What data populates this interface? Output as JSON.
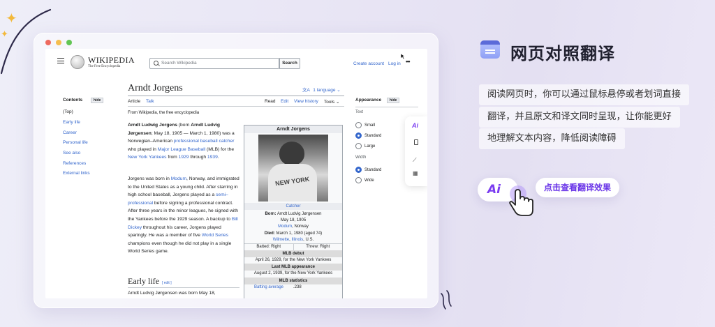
{
  "wiki": {
    "logo_title": "WIKIPEDIA",
    "logo_subtitle": "The Free Encyclopedia",
    "search_placeholder": "Search Wikipedia",
    "search_button": "Search",
    "create_account": "Create account",
    "login": "Log in",
    "more": "•••"
  },
  "toc": {
    "title": "Contents",
    "hide": "hide",
    "items": [
      "(Top)",
      "Early life",
      "Career",
      "Personal life",
      "See also",
      "References",
      "External links"
    ]
  },
  "article": {
    "title": "Arndt Jorgens",
    "language": "1 language",
    "tabs": [
      "Article",
      "Talk"
    ],
    "actions": [
      "Read",
      "Edit",
      "View history",
      "Tools"
    ],
    "from": "From Wikipedia, the free encyclopedia",
    "para1": [
      {
        "t": "Arndt Ludwig Jorgens",
        "s": "b"
      },
      {
        "t": " (born "
      },
      {
        "t": "Arndt Ludvig Jørgensen",
        "s": "b"
      },
      {
        "t": "; May 18, 1905 — March 1, 1980) was a Norwegian–American "
      },
      {
        "t": "professional baseball",
        "s": "a"
      },
      {
        "t": " "
      },
      {
        "t": "catcher",
        "s": "a"
      },
      {
        "t": " who played in "
      },
      {
        "t": "Major League Baseball",
        "s": "a"
      },
      {
        "t": " (MLB) for the "
      },
      {
        "t": "New York Yankees",
        "s": "a"
      },
      {
        "t": " from "
      },
      {
        "t": "1929",
        "s": "a"
      },
      {
        "t": " through "
      },
      {
        "t": "1939",
        "s": "a"
      },
      {
        "t": "."
      }
    ],
    "para2": [
      {
        "t": "Jorgens was born in "
      },
      {
        "t": "Modum",
        "s": "a"
      },
      {
        "t": ", Norway, and immigrated to the United States as a young child. After starring in high school baseball, Jorgens played as a "
      },
      {
        "t": "semi–professional",
        "s": "a"
      },
      {
        "t": " before signing a professional contract. After three years in the minor leagues, he signed with the Yankees before the 1929 season. A backup to "
      },
      {
        "t": "Bill Dickey",
        "s": "a"
      },
      {
        "t": " throughout his career, Jorgens played sparingly. He was a member of five "
      },
      {
        "t": "World Series",
        "s": "a"
      },
      {
        "t": " champions even though he did not play in a single World Series game."
      }
    ],
    "early_life": "Early life",
    "edit": "[ edit ]",
    "para3": "Arndt Ludvig Jørgensen was born May 18,"
  },
  "infobox": {
    "name": "Arndt Jorgens",
    "position": "Catcher",
    "born_label": "Born:",
    "born_name": "Arndt Ludvig Jørgensen",
    "born_date": "May 18, 1905",
    "born_place": "Modum",
    "born_country": ", Norway",
    "died_label": "Died:",
    "died_date": "March 1, 1980 (aged 74)",
    "died_place_a": "Wilmette",
    "died_place_b": "Illinois",
    "died_country": ", U.S.",
    "batted": "Batted: Right",
    "threw": "Threw: Right",
    "debut_label": "MLB debut",
    "debut": "April 26, 1929, for the New York Yankees",
    "last_label": "Last MLB appearance",
    "last": "August 2, 1939, for the New York Yankees",
    "stats_label": "MLB statistics",
    "stat_name": "Batting average",
    "stat_value": ".238"
  },
  "appearance": {
    "title": "Appearance",
    "hide": "hide",
    "text_label": "Text",
    "text_options": [
      "Small",
      "Standard",
      "Large"
    ],
    "text_selected": 1,
    "width_label": "Width",
    "width_options": [
      "Standard",
      "Wide"
    ],
    "width_selected": 0
  },
  "promo": {
    "title": "网页对照翻译",
    "desc": [
      "阅读网页时，你可以通过鼠标悬停或者划词直接",
      "翻译，并且原文和译文同时呈现，让你能更好",
      "地理解文本内容，降低阅读障碍"
    ],
    "cta": "点击查看翻译效果",
    "ai_logo": "Ai"
  },
  "colors": {
    "accent": "#6a35e8",
    "link": "#3366cc",
    "star": "#f3b93b",
    "traffic": [
      "#ee6a5f",
      "#f5be4f",
      "#62c554"
    ]
  }
}
